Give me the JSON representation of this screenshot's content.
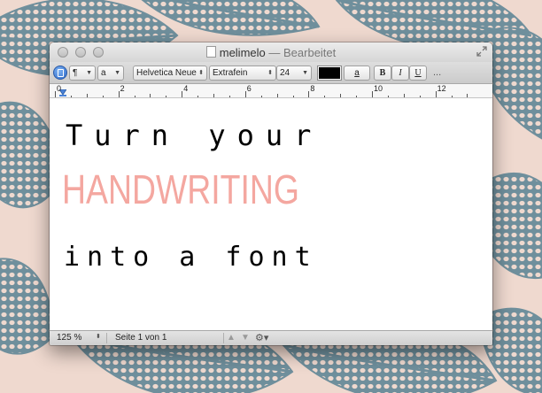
{
  "window": {
    "title": "melimelo",
    "title_separator": "—",
    "status": "Bearbeitet"
  },
  "toolbar": {
    "paragraph_symbol": "¶",
    "char_style": "a",
    "font_family": "Helvetica Neue",
    "font_weight": "Extrafein",
    "font_size": "24",
    "text_color": "#000000",
    "highlight_label": "a",
    "bold": "B",
    "italic": "I",
    "underline": "U",
    "more": "..."
  },
  "ruler": {
    "labels": [
      "0",
      "2",
      "4",
      "6",
      "8",
      "10",
      "12"
    ]
  },
  "document": {
    "line1": "Turn your",
    "line2": "HANDWRITING",
    "line3": "into a font",
    "line1_color": "#000000",
    "line2_color": "#f4a7a0",
    "line3_color": "#000000"
  },
  "statusbar": {
    "zoom": "125 %",
    "page_info": "Seite 1 von 1"
  },
  "colors": {
    "wallpaper_bg": "#efd9cf",
    "leaf_color": "#6f8f9c"
  }
}
